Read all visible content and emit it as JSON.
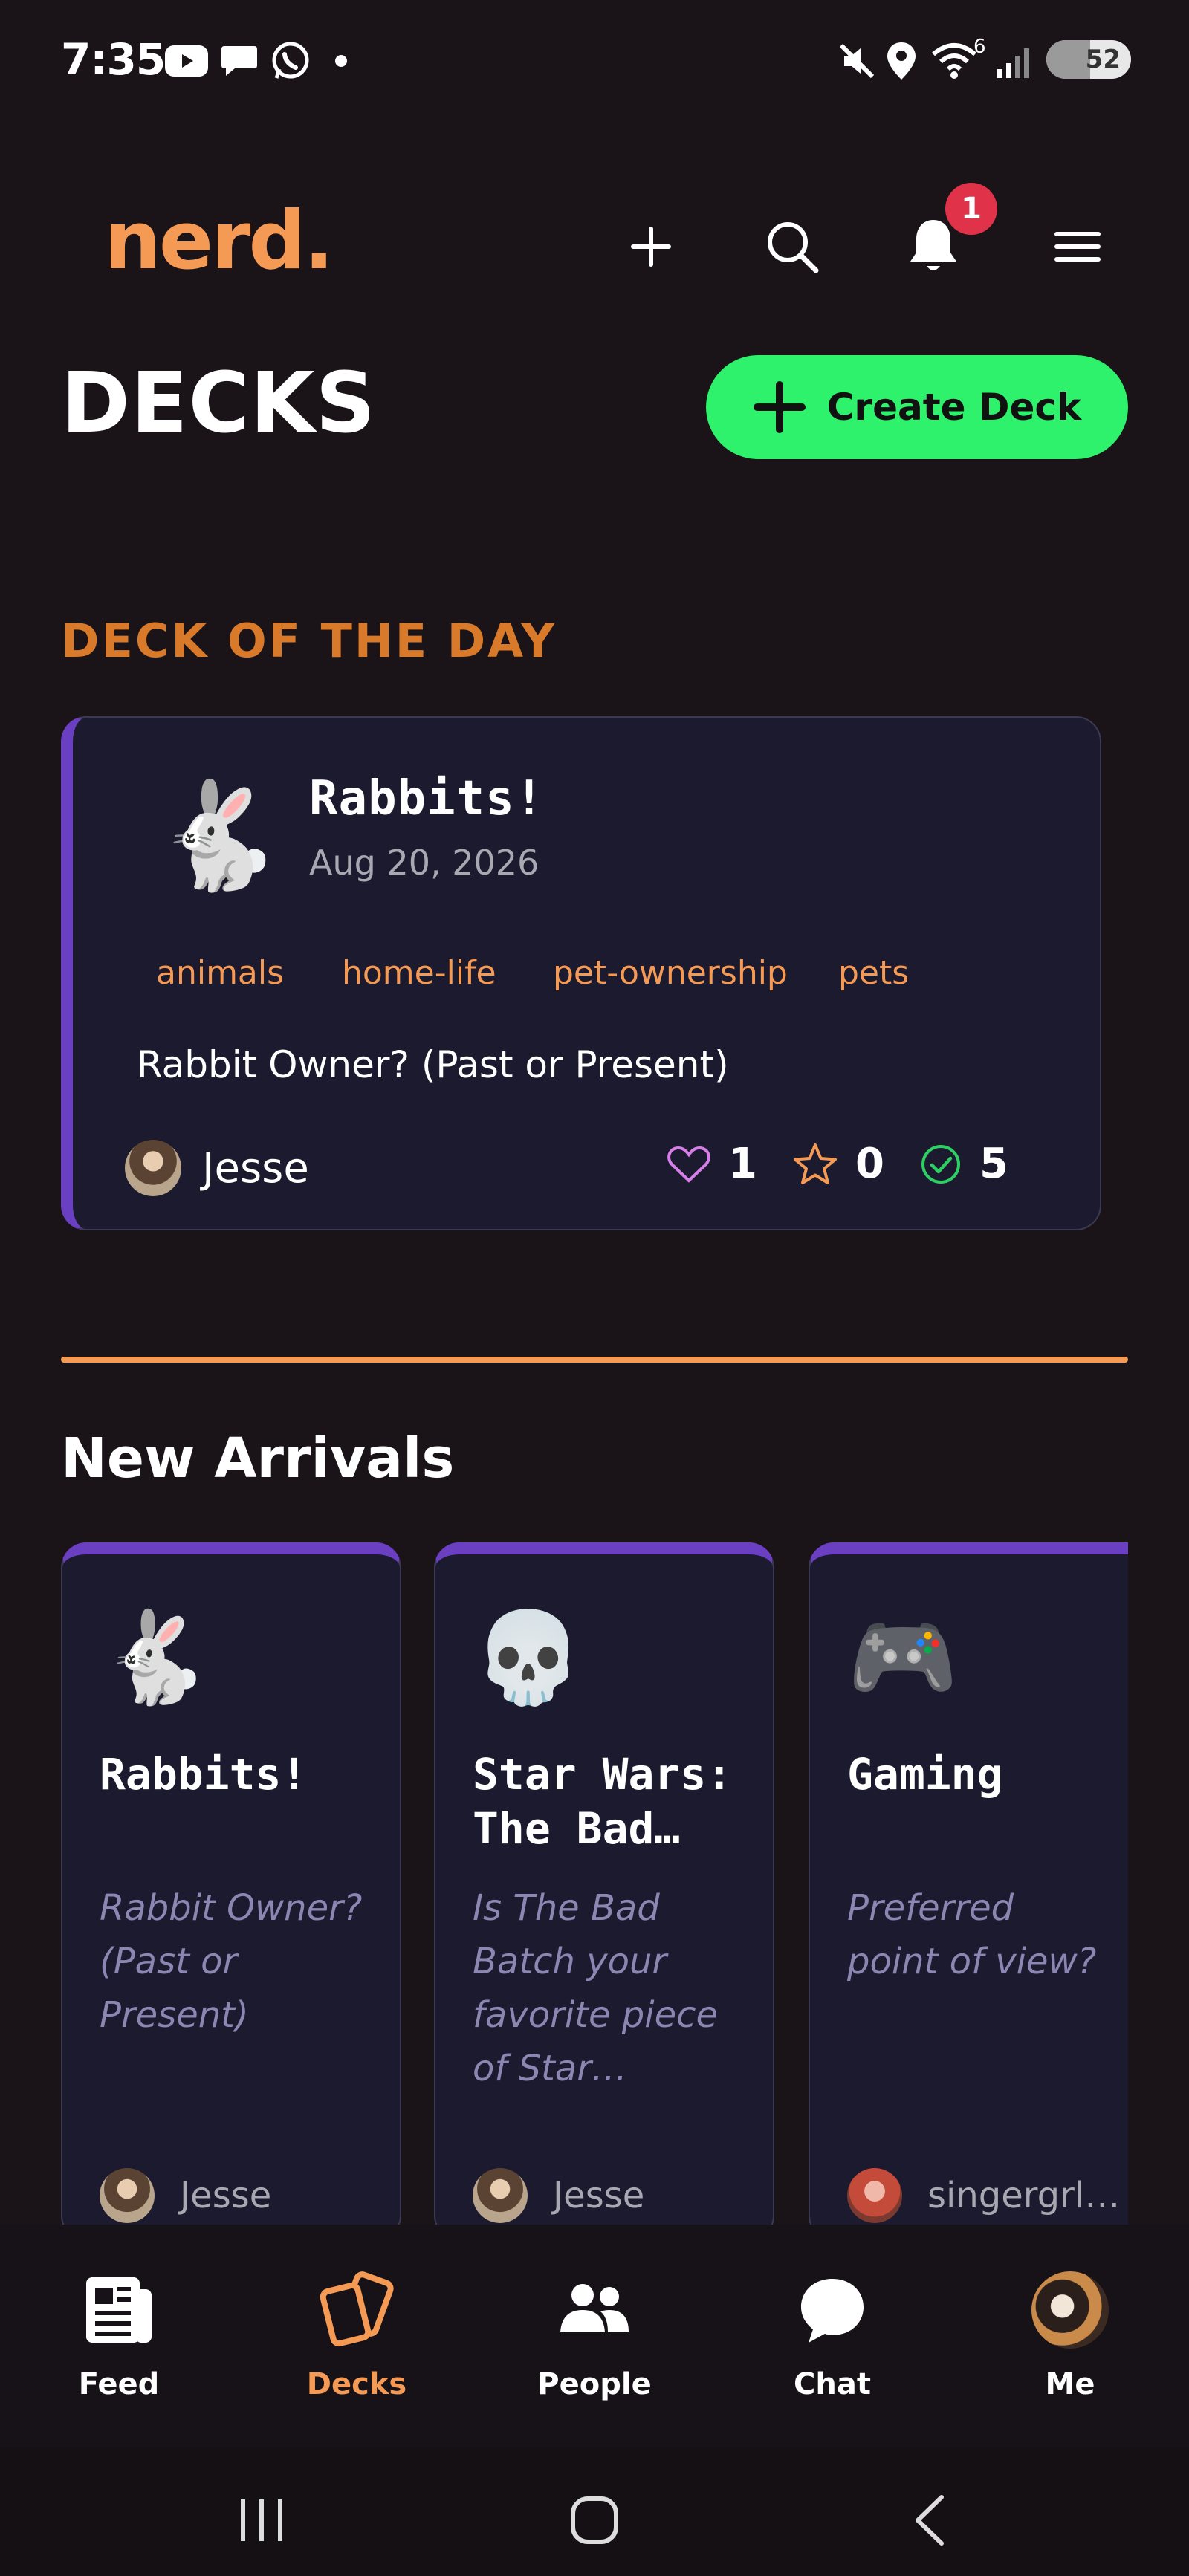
{
  "status_bar": {
    "time": "7:35",
    "wifi_label": "6",
    "battery": "52",
    "battery_level": 0.52
  },
  "header": {
    "logo": "nerd.",
    "notification_count": "1"
  },
  "page": {
    "title": "DECKS",
    "create_button": "Create Deck"
  },
  "deck_of_day": {
    "section_title": "DECK OF THE DAY",
    "emoji": "🐇",
    "title": "Rabbits!",
    "date": "Aug 20, 2026",
    "tags": [
      "animals",
      "home-life",
      "pet-ownership",
      "pets"
    ],
    "question": "Rabbit Owner? (Past or Present)",
    "author": "Jesse",
    "likes": "1",
    "stars": "0",
    "completions": "5"
  },
  "new_arrivals": {
    "section_title": "New Arrivals",
    "cards": [
      {
        "emoji": "🐇",
        "title": "Rabbits!",
        "question": "Rabbit Owner? (Past or Present)",
        "author": "Jesse"
      },
      {
        "emoji": "💀",
        "title": "Star Wars: The Bad…",
        "question": "Is The Bad Batch your favorite piece of Star…",
        "author": "Jesse"
      },
      {
        "emoji": "🎮",
        "title": "Gaming",
        "question": "Preferred point of view?",
        "author": "singergrl…"
      }
    ]
  },
  "bottom_nav": {
    "items": [
      {
        "label": "Feed"
      },
      {
        "label": "Decks"
      },
      {
        "label": "People"
      },
      {
        "label": "Chat"
      },
      {
        "label": "Me"
      }
    ],
    "active": "Decks"
  },
  "colors": {
    "background": "#1a1419",
    "accent_orange": "#f59a54",
    "accent_green": "#2ef26c",
    "accent_purple": "#6a3fc2",
    "badge_red": "#e0334a"
  },
  "icons": [
    "youtube-icon",
    "message-icon",
    "whatsapp-icon",
    "mute-icon",
    "location-icon",
    "wifi-icon",
    "signal-icon",
    "plus-icon",
    "search-icon",
    "bell-icon",
    "menu-icon",
    "heart-icon",
    "star-icon",
    "check-circle-icon",
    "feed-icon",
    "decks-icon",
    "people-icon",
    "chat-icon"
  ]
}
